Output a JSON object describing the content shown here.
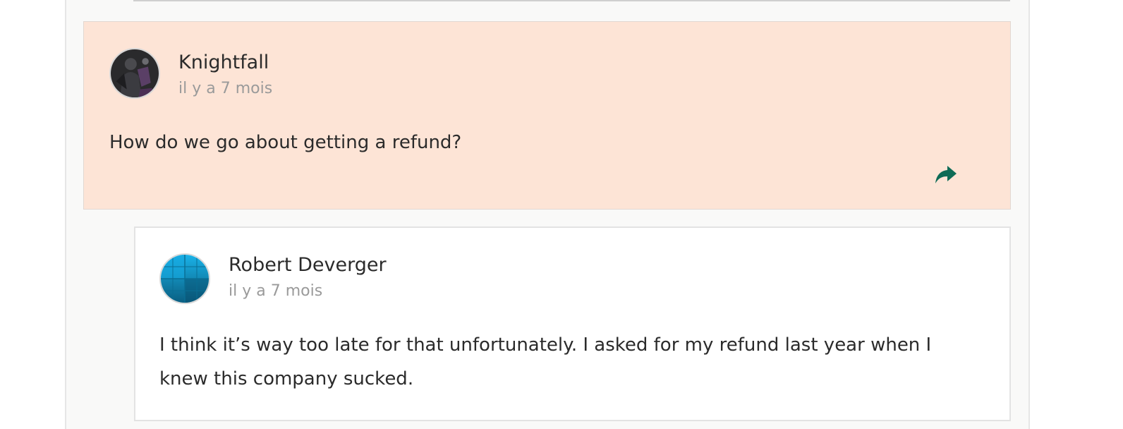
{
  "colors": {
    "highlight_background": "#fde4d6",
    "accent": "#0e6b56",
    "author_text": "#2b2b2b",
    "timestamp_text": "#9a9a9a"
  },
  "comments": [
    {
      "author": "Knightfall",
      "timestamp": "il y a 7 mois",
      "body": "How do we go about getting a refund?",
      "avatar_icon": "knight-avatar-icon",
      "action_icon": "share-reply-icon"
    },
    {
      "author": "Robert Deverger",
      "timestamp": "il y a 7 mois",
      "body": "I think it’s way too late for that unfortunately. I asked for my refund last year when I knew this company sucked.",
      "avatar_icon": "blue-globe-avatar-icon"
    }
  ]
}
